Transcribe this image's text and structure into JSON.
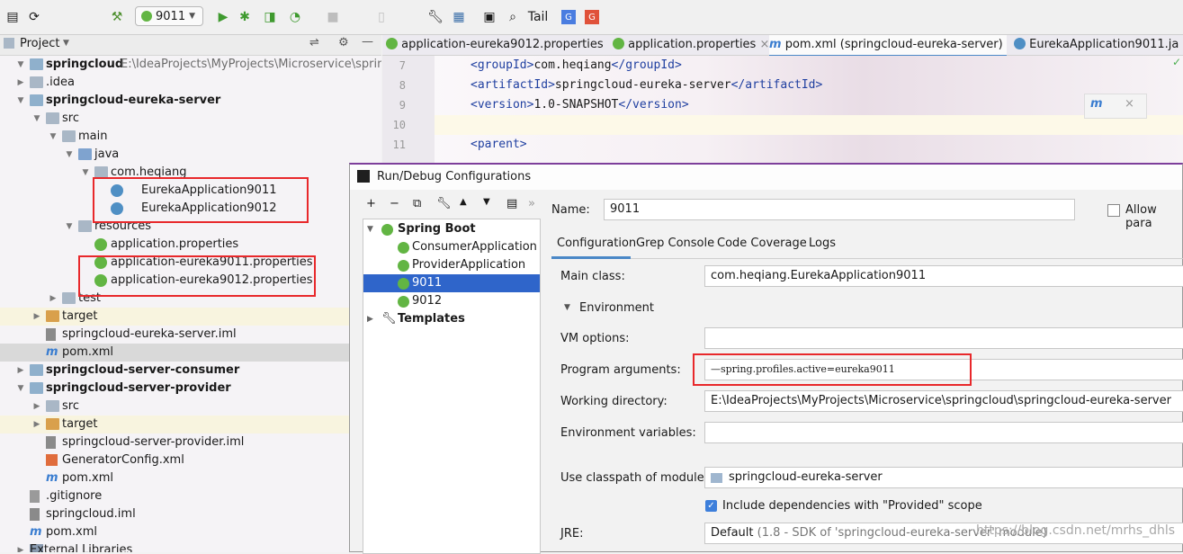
{
  "toolbar": {
    "config_name": "9011",
    "tail_label": "Tail"
  },
  "project_panel": {
    "title": "Project",
    "tree": [
      {
        "label": "springcloud",
        "path": "E:\\IdeaProjects\\MyProjects\\Microservice\\springcloud"
      },
      {
        "label": ".idea"
      },
      {
        "label": "springcloud-eureka-server"
      },
      {
        "label": "src"
      },
      {
        "label": "main"
      },
      {
        "label": "java"
      },
      {
        "label": "com.heqiang"
      },
      {
        "label": "EurekaApplication9011"
      },
      {
        "label": "EurekaApplication9012"
      },
      {
        "label": "resources"
      },
      {
        "label": "application.properties"
      },
      {
        "label": "application-eureka9011.properties"
      },
      {
        "label": "application-eureka9012.properties"
      },
      {
        "label": "test"
      },
      {
        "label": "target"
      },
      {
        "label": "springcloud-eureka-server.iml"
      },
      {
        "label": "pom.xml"
      },
      {
        "label": "springcloud-server-consumer"
      },
      {
        "label": "springcloud-server-provider"
      },
      {
        "label": "src"
      },
      {
        "label": "target"
      },
      {
        "label": "springcloud-server-provider.iml"
      },
      {
        "label": "GeneratorConfig.xml"
      },
      {
        "label": "pom.xml"
      },
      {
        "label": ".gitignore"
      },
      {
        "label": "springcloud.iml"
      },
      {
        "label": "pom.xml"
      },
      {
        "label": "External Libraries"
      }
    ]
  },
  "editor": {
    "tabs": [
      {
        "label": "application-eureka9012.properties"
      },
      {
        "label": "application.properties"
      },
      {
        "label": "pom.xml (springcloud-eureka-server)"
      },
      {
        "label": "EurekaApplication9011.ja"
      }
    ],
    "lines": [
      {
        "num": "7",
        "open": "<groupId>",
        "text": "com.heqiang",
        "close": "</groupId>"
      },
      {
        "num": "8",
        "open": "<artifactId>",
        "text": "springcloud-eureka-server",
        "close": "</artifactId>"
      },
      {
        "num": "9",
        "open": "<version>",
        "text": "1.0-SNAPSHOT",
        "close": "</version>"
      },
      {
        "num": "10",
        "open": "",
        "text": "",
        "close": ""
      },
      {
        "num": "11",
        "open": "<parent>",
        "text": "",
        "close": ""
      }
    ]
  },
  "dialog": {
    "title": "Run/Debug Configurations",
    "tree": {
      "group": "Spring Boot",
      "items": [
        "ConsumerApplication",
        "ProviderApplication",
        "9011",
        "9012"
      ],
      "templates": "Templates"
    },
    "name_label": "Name:",
    "name_value": "9011",
    "allow_parallel": "Allow para",
    "tabs": [
      "Configuration",
      "Grep Console",
      "Code Coverage",
      "Logs"
    ],
    "main_class_label": "Main class:",
    "main_class_value": "com.heqiang.EurekaApplication9011",
    "environment_label": "Environment",
    "vm_options_label": "VM options:",
    "vm_options_value": "",
    "program_args_label": "Program arguments:",
    "program_args_value": "—spring.profiles.active=eureka9011",
    "working_dir_label": "Working directory:",
    "working_dir_value": "E:\\IdeaProjects\\MyProjects\\Microservice\\springcloud\\springcloud-eureka-server",
    "env_vars_label": "Environment variables:",
    "env_vars_value": "",
    "classpath_label": "Use classpath of module:",
    "classpath_value": "springcloud-eureka-server",
    "include_deps_label": "Include dependencies with \"Provided\" scope",
    "jre_label": "JRE:",
    "jre_value": "Default",
    "jre_detail": "(1.8 - SDK of 'springcloud-eureka-server' module)"
  },
  "watermark": "https://blog.csdn.net/mrhs_dhls"
}
